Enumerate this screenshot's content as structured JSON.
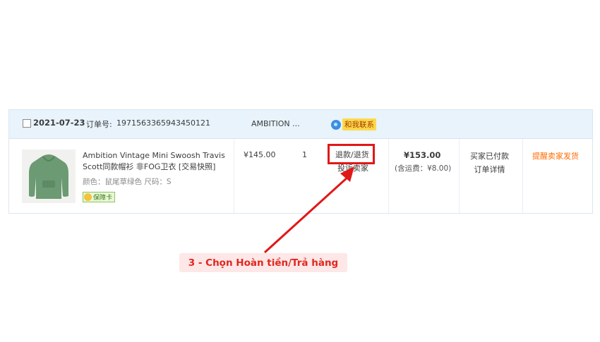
{
  "order": {
    "date": "2021-07-23",
    "order_no_label": "订单号:",
    "order_no": "1971563365943450121",
    "shop": "AMBITION ...",
    "contact_label": "和我联系"
  },
  "product": {
    "title": "Ambition Vintage Mini Swoosh Travis Scott同款帽衫 非FOG卫衣 [交易快照]",
    "attrs": "颜色：鼠尾草绿色   尺码：S",
    "guarantee": "保障卡",
    "price": "¥145.00",
    "qty": "1",
    "refund_label": "退款/退货",
    "complaint_label": "投诉卖家",
    "total": "¥153.00",
    "shipping": "(含运费：¥8.00)",
    "status": "买家已付款",
    "details_label": "订单详情",
    "remind_label": "提醒卖家发货"
  },
  "annotation": {
    "text": "3 - Chọn Hoàn tiền/Trả hàng",
    "color": "#e01818"
  }
}
